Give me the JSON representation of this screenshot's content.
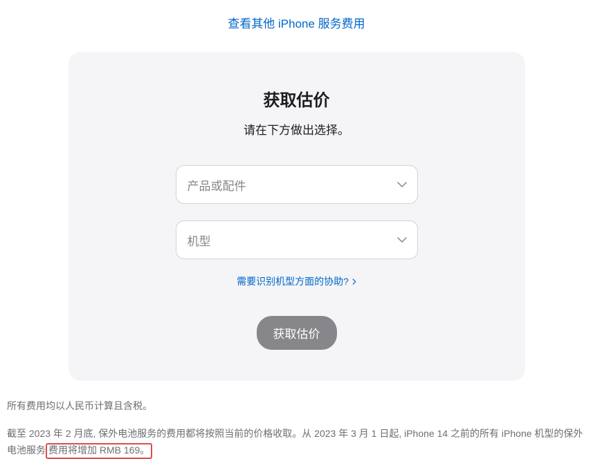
{
  "topLink": {
    "label": "查看其他 iPhone 服务费用"
  },
  "card": {
    "title": "获取估价",
    "subtitle": "请在下方做出选择。",
    "productSelect": {
      "placeholder": "产品或配件"
    },
    "modelSelect": {
      "placeholder": "机型"
    },
    "helpLink": {
      "label": "需要识别机型方面的协助?"
    },
    "submitButton": {
      "label": "获取估价"
    }
  },
  "footer": {
    "line1": "所有费用均以人民币计算且含税。",
    "line2_part1": "截至 2023 年 2 月底, 保外电池服务的费用都将按照当前的价格收取。从 2023 年 3 月 1 日起, iPhone 14 之前的所有 iPhone 机型的保外电池服务",
    "line2_highlight": "费用将增加 RMB 169。"
  }
}
